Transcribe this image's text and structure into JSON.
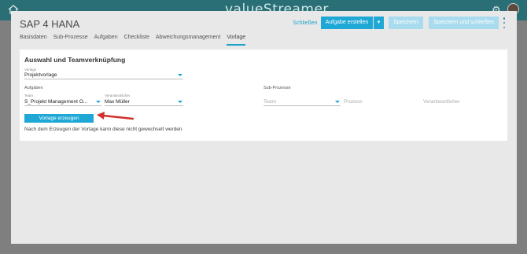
{
  "app_bar": {
    "brand": "valueStreamer",
    "home_icon": "home-icon",
    "settings_icon": "gear-icon"
  },
  "modal": {
    "title": "SAP 4 HANA",
    "actions": {
      "close_label": "Schließen",
      "create_task_label": "Aufgabe erstellen",
      "save_label": "Speichern",
      "save_close_label": "Speichern und schließen"
    },
    "tabs": [
      {
        "label": "Basisdaten"
      },
      {
        "label": "Sub-Prozesse"
      },
      {
        "label": "Aufgaben"
      },
      {
        "label": "Checkliste"
      },
      {
        "label": "Abweichungsmanagement"
      },
      {
        "label": "Vorlage",
        "active": true
      }
    ]
  },
  "card": {
    "title": "Auswahl und Teamverknüpfung",
    "template": {
      "label": "Vorlage",
      "value": "Projektvorlage"
    },
    "tasks": {
      "section_label": "Aufgaben",
      "team_label": "Team",
      "team_value": "S_Projekt Management O...",
      "responsible_label": "Verantwortlicher",
      "responsible_value": "Max Müller"
    },
    "sub_processes": {
      "section_label": "Sub-Prozesse",
      "team_placeholder": "Team",
      "process_placeholder": "Prozess",
      "responsible_placeholder": "Verantwortlicher"
    },
    "create_button_label": "Vorlage erzeugen",
    "note": "Nach dem Erzeugen der Vorlage kann diese nicht gewechselt werden"
  },
  "colors": {
    "accent": "#1fa8d6",
    "arrow": "#d0312d",
    "header": "#2a6f76"
  }
}
